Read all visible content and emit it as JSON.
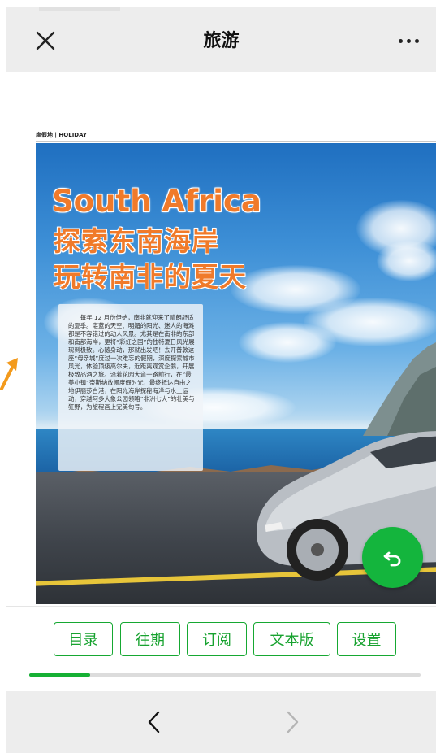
{
  "topbar": {
    "title": "旅游",
    "close_icon": "close-icon",
    "more_icon": "more-horizontal-icon"
  },
  "magazine": {
    "section_label": "度假地 | HOLIDAY",
    "title_en": "South Africa",
    "title_cn_line1": "探索东南海岸",
    "title_cn_line2": "玩转南非的夏天",
    "body": "每年 12 月份伊始，南非就迎来了晴朗舒适的夏季。湛蓝的天空、明媚的阳光、迷人的海滩都是不容错过的动人风景。尤其是在南非的东部和南部海岸，更将“彩虹之国”的独特夏日风光展现到极致。心随身动，那就出发吧！去开普敦这座“母亲城”度过一次难忘的假期，深度探索城市风光，体验顶级高尔夫，近距离观赏企鹅，开展极致品酒之旅。沿着花园大道一路前行，在“最美小镇”奈斯纳放慢度假时光，最终抵达自由之地伊丽莎白港，在阳光海岸探秘海洋与水上运动，穿越阿多大象公园领略“非洲七大”的壮美与狂野，为旅程画上完美句号。"
  },
  "fab": {
    "icon": "return-arrow-icon",
    "color": "#14b53d"
  },
  "menu": {
    "items": [
      {
        "label": "目录"
      },
      {
        "label": "往期"
      },
      {
        "label": "订阅"
      },
      {
        "label": "文本版"
      },
      {
        "label": "设置"
      }
    ],
    "accent": "#16a832"
  },
  "progress": {
    "fraction": 0.155,
    "color": "#16b034"
  },
  "bottombar": {
    "back_icon": "chevron-left-icon",
    "forward_icon": "chevron-right-icon"
  }
}
